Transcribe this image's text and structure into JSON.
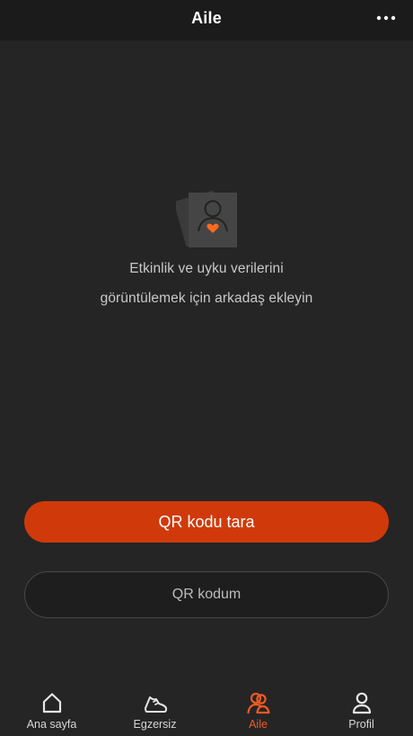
{
  "header": {
    "title": "Aile",
    "more_icon": "more-horizontal-icon"
  },
  "empty_state": {
    "icon": "friend-photo-heart-icon",
    "accent_color": "#ff6a1f",
    "line1": "Etkinlik ve uyku verilerini",
    "line2": "görüntülemek için arkadaş ekleyin"
  },
  "actions": {
    "scan_qr_label": "QR kodu tara",
    "scan_qr_color": "#d03a0b",
    "my_qr_label": "QR kodum"
  },
  "tab_bar": {
    "active_color": "#f05a22",
    "items": [
      {
        "label": "Ana sayfa",
        "icon": "home-icon",
        "active": false
      },
      {
        "label": "Egzersiz",
        "icon": "shoe-icon",
        "active": false
      },
      {
        "label": "Aile",
        "icon": "family-icon",
        "active": true
      },
      {
        "label": "Profil",
        "icon": "profile-icon",
        "active": false
      }
    ]
  }
}
